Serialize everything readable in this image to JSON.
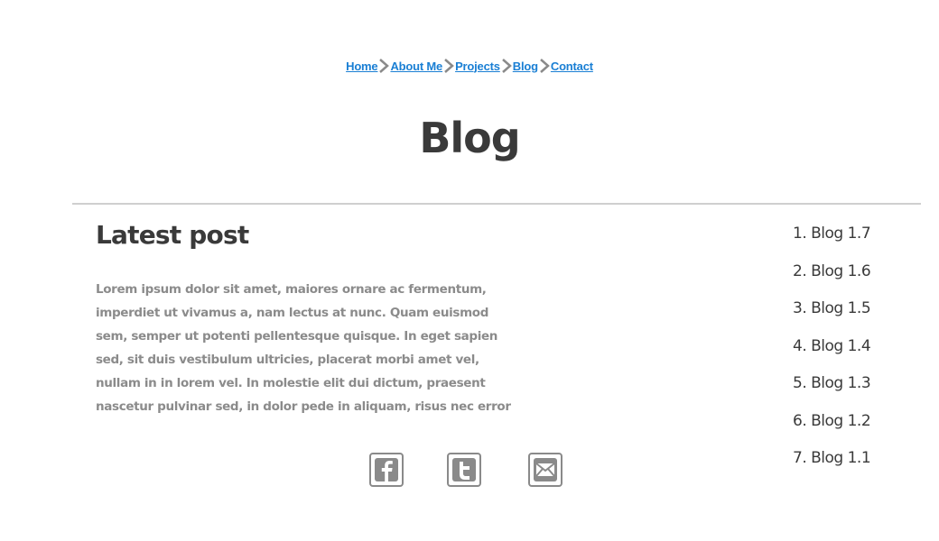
{
  "breadcrumb": {
    "items": [
      {
        "label": "Home"
      },
      {
        "label": "About Me"
      },
      {
        "label": "Projects"
      },
      {
        "label": "Blog"
      },
      {
        "label": "Contact"
      }
    ]
  },
  "page": {
    "title": "Blog"
  },
  "post": {
    "heading": "Latest post",
    "lines": [
      "Lorem ipsum dolor sit amet, maiores ornare ac fermentum,",
      "imperdiet ut vivamus a, nam lectus at nunc. Quam euismod",
      "sem, semper ut potenti pellentesque quisque. In eget sapien",
      "sed, sit duis vestibulum ultricies, placerat morbi amet vel,",
      "nullam in in lorem vel. In molestie elit dui dictum, praesent",
      "nascetur pulvinar sed, in dolor pede in aliquam, risus nec error"
    ]
  },
  "social": {
    "buttons": [
      {
        "icon": "facebook-icon"
      },
      {
        "icon": "twitter-icon"
      },
      {
        "icon": "mail-icon"
      }
    ]
  },
  "sidebar": {
    "items": [
      {
        "label": "1. Blog 1.7"
      },
      {
        "label": "2. Blog 1.6"
      },
      {
        "label": "3. Blog 1.5"
      },
      {
        "label": "4. Blog 1.4"
      },
      {
        "label": "5. Blog 1.3"
      },
      {
        "label": "6. Blog 1.2"
      },
      {
        "label": "7. Blog 1.1"
      }
    ]
  },
  "colors": {
    "link": "#1a7fd4",
    "heading": "#3a3a3a",
    "body_text": "#8b8b8b",
    "divider": "#cfcfcf",
    "icon": "#8a8a8a"
  }
}
